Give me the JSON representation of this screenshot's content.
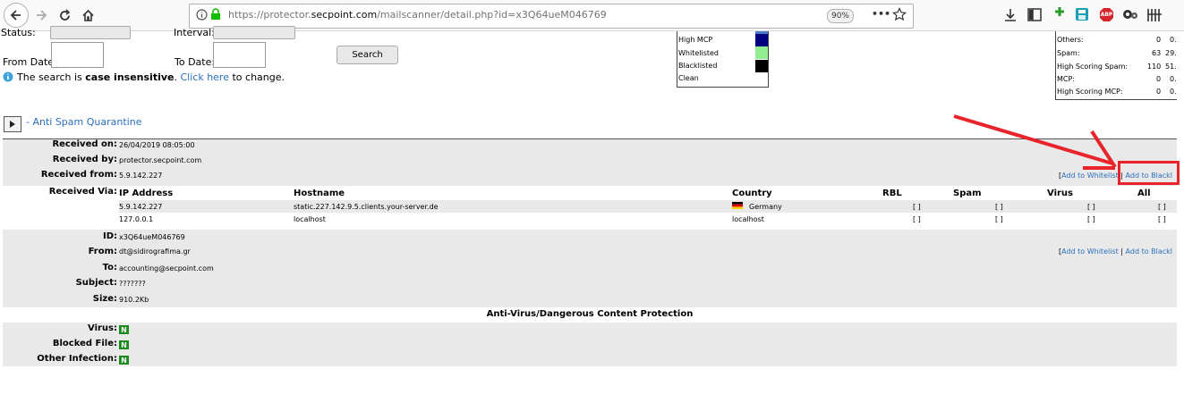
{
  "browser": {
    "url_prefix": "https://protector.",
    "url_domain": "secpoint.com",
    "url_path": "/mailscanner/detail.php?id=x3Q64ueM046769",
    "zoom": "90%",
    "more_icon": "•••",
    "abp_label": "ABP"
  },
  "filters": {
    "status_label": "Status:",
    "interval_label": "Interval:",
    "from_date_label": "From Date:",
    "to_date_label": "To Date:",
    "search_button": "Search",
    "note_prefix": "The search is ",
    "note_bold": "case insensitive",
    "note_mid": ". ",
    "note_link": "Click here",
    "note_suffix": " to change."
  },
  "legend": {
    "items": [
      {
        "label": "High MCP",
        "color": "#000080"
      },
      {
        "label": "Whitelisted",
        "color": "#90ee90"
      },
      {
        "label": "Blacklisted",
        "color": "#000000"
      },
      {
        "label": "Clean",
        "color": "#ffffff"
      }
    ]
  },
  "stats": {
    "rows": [
      {
        "label": "Others:",
        "count": "0",
        "pct": "0."
      },
      {
        "label": "Spam:",
        "count": "63",
        "pct": "29."
      },
      {
        "label": "High Scoring Spam:",
        "count": "110",
        "pct": "51."
      },
      {
        "label": "MCP:",
        "count": "0",
        "pct": "0."
      },
      {
        "label": "High Scoring MCP:",
        "count": "0",
        "pct": "0."
      }
    ]
  },
  "section": {
    "title": "- Anti Spam Quarantine"
  },
  "message": {
    "received_on_label": "Received on:",
    "received_on": "26/04/2019 08:05:00",
    "received_by_label": "Received by:",
    "received_by": "protector.secpoint.com",
    "received_from_label": "Received from:",
    "received_from": "5.9.142.227",
    "received_via_label": "Received Via:",
    "id_label": "ID:",
    "id": "x3Q64ueM046769",
    "from_label": "From:",
    "from": "dt@sidirografima.gr",
    "to_label": "To:",
    "to": "accounting@secpoint.com",
    "subject_label": "Subject:",
    "subject": "???????",
    "size_label": "Size:",
    "size": "910.2Kb"
  },
  "actions": {
    "open_bracket": "[",
    "whitelist": "Add to Whitelist",
    "sep": " | ",
    "blacklist": "Add to Blackl"
  },
  "relay_table": {
    "headers": [
      "IP Address",
      "Hostname",
      "Country",
      "RBL",
      "Spam",
      "Virus",
      "All"
    ],
    "rows": [
      {
        "ip": "5.9.142.227",
        "host": "static.227.142.9.5.clients.your-server.de",
        "country": "Germany",
        "rbl": "[ ]",
        "spam": "[ ]",
        "virus": "[ ]",
        "all": "[ ]"
      },
      {
        "ip": "127.0.0.1",
        "host": "localhost",
        "country": "localhost",
        "rbl": "[ ]",
        "spam": "[ ]",
        "virus": "[ ]",
        "all": "[ ]"
      }
    ]
  },
  "av": {
    "heading": "Anti-Virus/Dangerous Content Protection",
    "virus_label": "Virus:",
    "blocked_label": "Blocked File:",
    "other_label": "Other Infection:",
    "virus": "N",
    "blocked": "N",
    "other": "N"
  },
  "annotation": {
    "color": "#e8242a"
  }
}
